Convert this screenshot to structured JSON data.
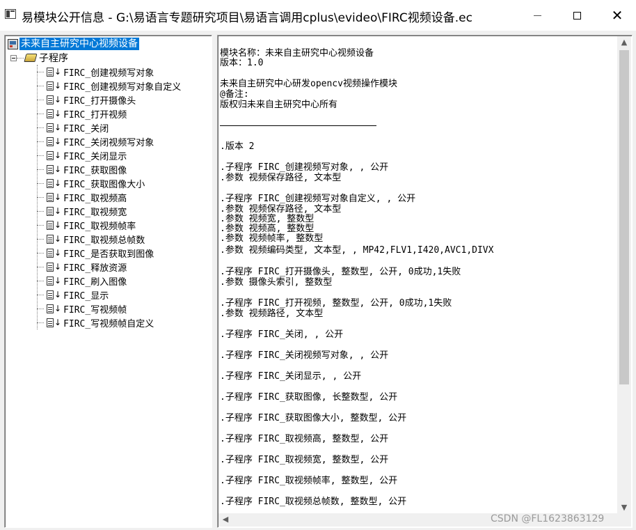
{
  "window": {
    "title": "易模块公开信息 - G:\\易语言专题研究项目\\易语言调用cplus\\evideo\\FIRC视频设备.ec",
    "minimize_glyph": "",
    "close_glyph": "✕"
  },
  "tree": {
    "root_label": "未来自主研究中心视频设备",
    "group_label": "子程序",
    "leaf_arrow": "↓",
    "items": [
      "FIRC_创建视频写对象",
      "FIRC_创建视频写对象自定义",
      "FIRC_打开摄像头",
      "FIRC_打开视频",
      "FIRC_关闭",
      "FIRC_关闭视频写对象",
      "FIRC_关闭显示",
      "FIRC_获取图像",
      "FIRC_获取图像大小",
      "FIRC_取视频高",
      "FIRC_取视频宽",
      "FIRC_取视频帧率",
      "FIRC_取视频总帧数",
      "FIRC_是否获取到图像",
      "FIRC_释放资源",
      "FIRC_刷入图像",
      "FIRC_显示",
      "FIRC_写视频帧",
      "FIRC_写视频帧自定义"
    ]
  },
  "document": {
    "lines": [
      "模块名称：未来自主研究中心视频设备",
      "版本：1.0",
      "未来自主研究中心研发opencv视频操作模块",
      "@备注:",
      "版权归未来自主研究中心所有",
      ".版本 2",
      ".子程序 FIRC_创建视频写对象, , 公开",
      ".参数 视频保存路径, 文本型",
      ".子程序 FIRC_创建视频写对象自定义, , 公开",
      ".参数 视频保存路径, 文本型",
      ".参数 视频宽, 整数型",
      ".参数 视频高, 整数型",
      ".参数 视频帧率, 整数型",
      ".参数 视频编码类型, 文本型, , MP42,FLV1,I420,AVC1,DIVX",
      ".子程序 FIRC_打开摄像头, 整数型, 公开, 0成功,1失败",
      ".参数 摄像头索引, 整数型",
      ".子程序 FIRC_打开视频, 整数型, 公开, 0成功,1失败",
      ".参数 视频路径, 文本型",
      ".子程序 FIRC_关闭, , 公开",
      ".子程序 FIRC_关闭视频写对象, , 公开",
      ".子程序 FIRC_关闭显示, , 公开",
      ".子程序 FIRC_获取图像, 长整数型, 公开",
      ".子程序 FIRC_获取图像大小, 整数型, 公开",
      ".子程序 FIRC_取视频高, 整数型, 公开",
      ".子程序 FIRC_取视频宽, 整数型, 公开",
      ".子程序 FIRC_取视频帧率, 整数型, 公开",
      ".子程序 FIRC_取视频总帧数, 整数型, 公开"
    ]
  },
  "scrollbars": {
    "up": "▲",
    "down": "▼",
    "left": "◀"
  },
  "watermark": "CSDN @FL1623863129"
}
